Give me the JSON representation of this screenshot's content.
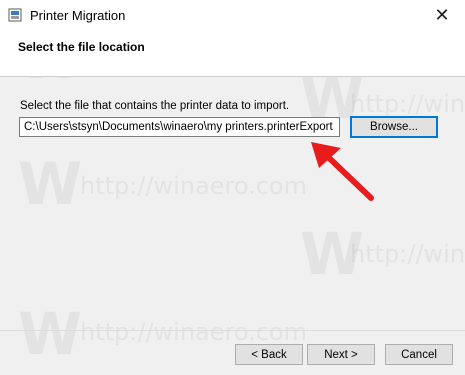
{
  "window": {
    "title": "Printer Migration",
    "icon": "printer-migration-app-icon",
    "close_glyph": "✕"
  },
  "header": {
    "title": "Select the file location"
  },
  "main": {
    "prompt": "Select the file that contains the printer data to import.",
    "file_path": "C:\\Users\\stsyn\\Documents\\winaero\\my printers.printerExport",
    "browse_label": "Browse..."
  },
  "footer": {
    "back_label": "< Back",
    "next_label": "Next >",
    "cancel_label": "Cancel"
  },
  "watermark": {
    "glyph": "W",
    "url": "http://winaero.com"
  },
  "annotation": {
    "arrow_color": "#e81c1c",
    "icon": "red-arrow-icon"
  },
  "colors": {
    "focus_border": "#0078d7",
    "panel_bg": "#f0f0f0"
  }
}
